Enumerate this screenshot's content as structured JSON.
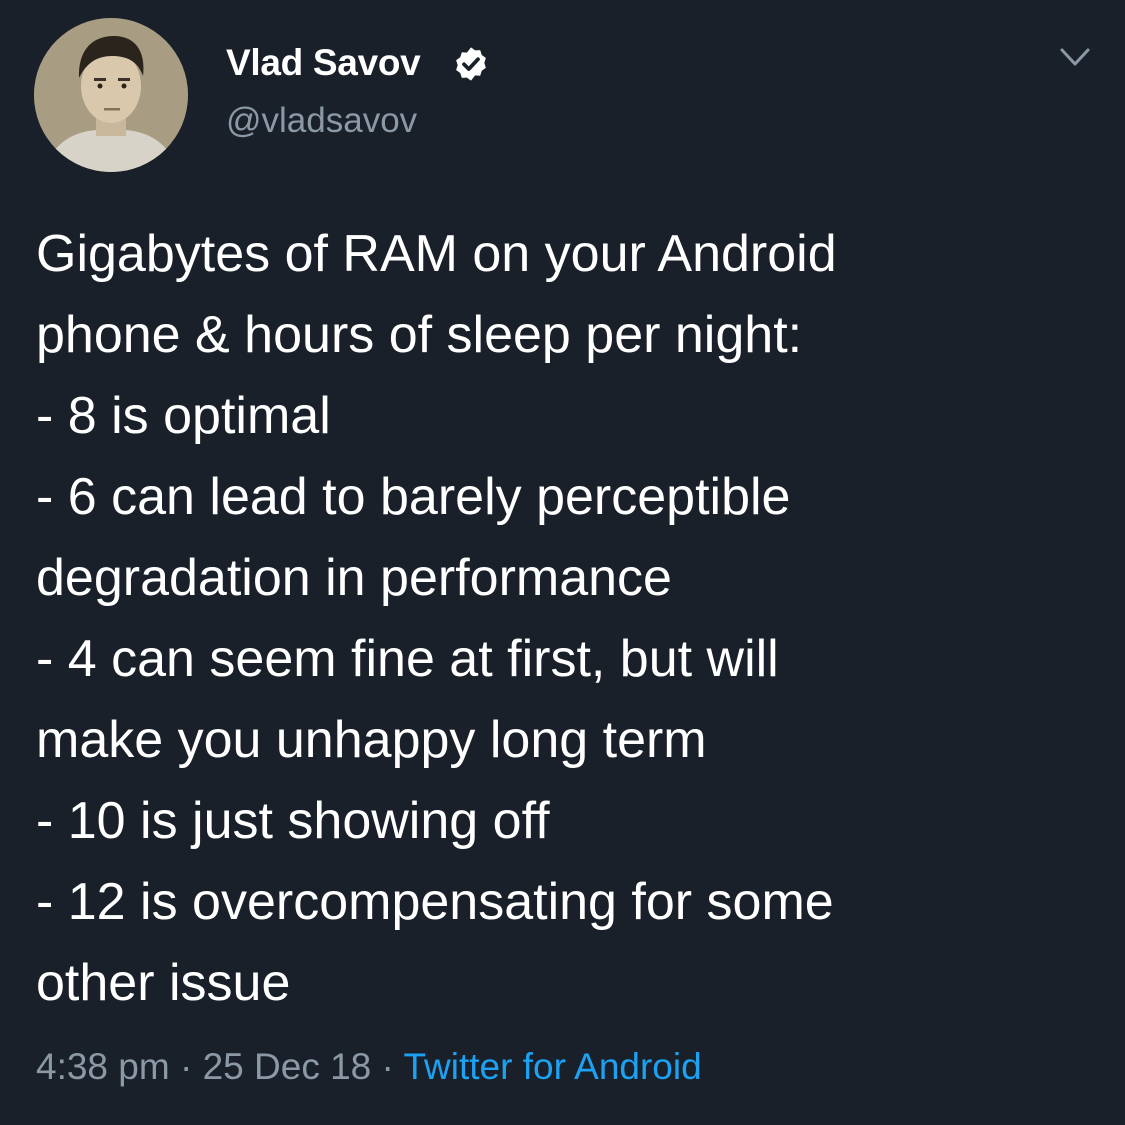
{
  "user": {
    "display_name": "Vlad Savov",
    "handle": "@vladsavov",
    "verified": true
  },
  "tweet": {
    "lines": [
      "Gigabytes of RAM on your Android",
      "phone & hours of sleep per night:",
      "- 8 is optimal",
      "- 6 can lead to barely perceptible",
      "degradation in performance",
      "- 4 can seem fine at first, but will",
      "make you unhappy long term",
      "- 10 is just showing off",
      "- 12 is overcompensating for some",
      "other issue"
    ],
    "time": "4:38 pm",
    "sep1": " · ",
    "date": "25 Dec 18",
    "sep2": " · ",
    "source": "Twitter for Android"
  },
  "icons": {
    "verified": "verified-badge-icon",
    "menu": "chevron-down-icon"
  },
  "colors": {
    "background": "#1a202a",
    "text": "#ffffff",
    "secondary_text": "#8b98a5",
    "link": "#1da1f2"
  }
}
